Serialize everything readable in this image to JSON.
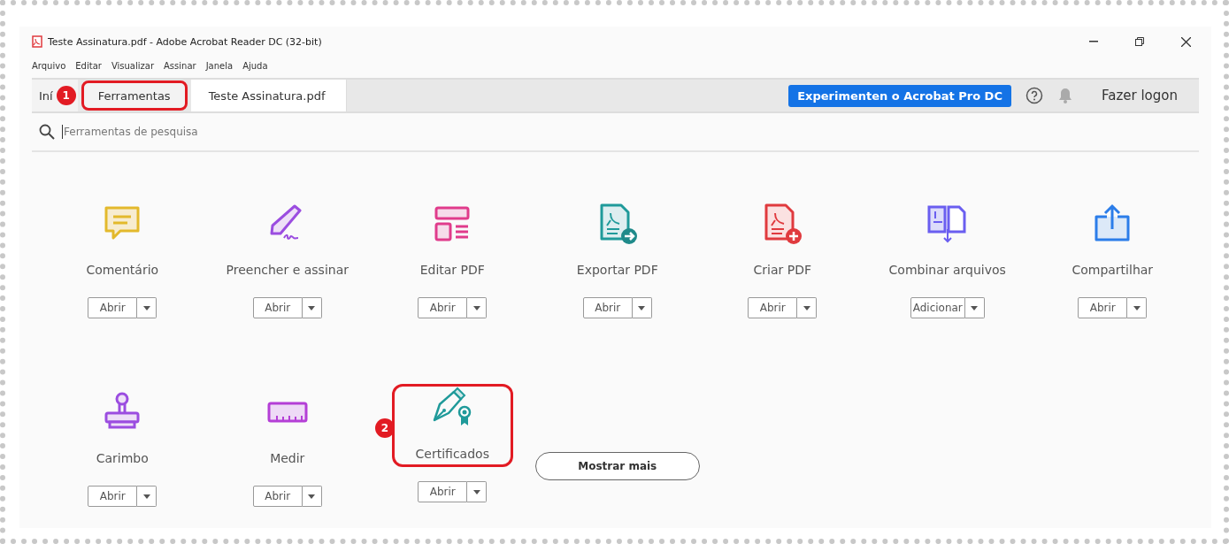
{
  "window": {
    "title": "Teste Assinatura.pdf - Adobe Acrobat Reader DC (32-bit)"
  },
  "menu": [
    "Arquivo",
    "Editar",
    "Visualizar",
    "Assinar",
    "Janela",
    "Ajuda"
  ],
  "tabs": [
    {
      "label": "Iní",
      "selected": false,
      "highlighted": false
    },
    {
      "label": "Ferramentas",
      "selected": false,
      "highlighted": true,
      "callout": "1"
    },
    {
      "label": "Teste Assinatura.pdf",
      "selected": true,
      "highlighted": false
    }
  ],
  "promo_button": "Experimenten o Acrobat Pro DC",
  "login": "Fazer logon",
  "search": {
    "placeholder": "Ferramentas de pesquisa"
  },
  "tools": [
    {
      "label": "Comentário",
      "kind": "comment",
      "action": "Abrir",
      "highlighted": false
    },
    {
      "label": "Preencher e assinar",
      "kind": "sign",
      "action": "Abrir",
      "highlighted": false
    },
    {
      "label": "Editar PDF",
      "kind": "edit",
      "action": "Abrir",
      "highlighted": false
    },
    {
      "label": "Exportar PDF",
      "kind": "export",
      "action": "Abrir",
      "highlighted": false
    },
    {
      "label": "Criar PDF",
      "kind": "create",
      "action": "Abrir",
      "highlighted": false
    },
    {
      "label": "Combinar arquivos",
      "kind": "combine",
      "action": "Adicionar",
      "highlighted": false
    },
    {
      "label": "Compartilhar",
      "kind": "share",
      "action": "Abrir",
      "highlighted": false
    },
    {
      "label": "Carimbo",
      "kind": "stamp",
      "action": "Abrir",
      "highlighted": false
    },
    {
      "label": "Medir",
      "kind": "measure",
      "action": "Abrir",
      "highlighted": false
    },
    {
      "label": "Certificados",
      "kind": "certificate",
      "action": "Abrir",
      "highlighted": true,
      "callout": "2"
    }
  ],
  "more_button": "Mostrar mais"
}
